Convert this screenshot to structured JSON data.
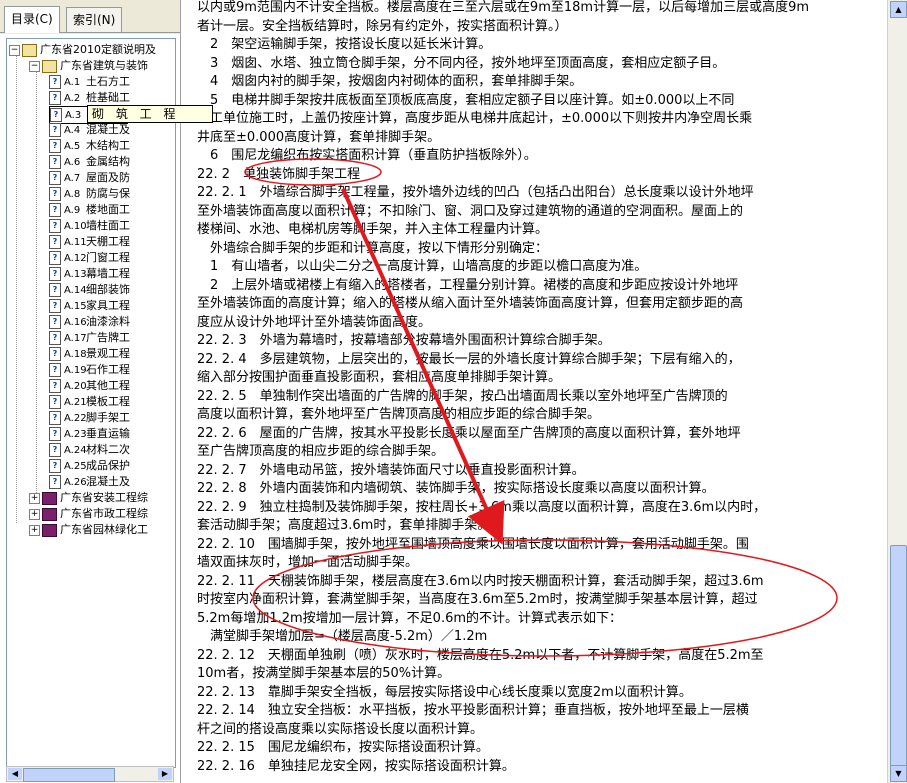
{
  "tabs": {
    "contents": "目录(C)",
    "index": "索引(N)"
  },
  "tree": {
    "root": "广东省2010定额说明及",
    "group1": "广东省建筑与装饰",
    "items": [
      {
        "code": "A.1",
        "label": "土石方工"
      },
      {
        "code": "A.2",
        "label": "桩基础工"
      },
      {
        "code": "A.3",
        "label": "砌 筑 工"
      },
      {
        "code": "A.4",
        "label": "混凝土及"
      },
      {
        "code": "A.5",
        "label": "木结构工"
      },
      {
        "code": "A.6",
        "label": "金属结构"
      },
      {
        "code": "A.7",
        "label": "屋面及防"
      },
      {
        "code": "A.8",
        "label": "防腐与保"
      },
      {
        "code": "A.9",
        "label": "楼地面工"
      },
      {
        "code": "A.10",
        "label": "墙柱面工"
      },
      {
        "code": "A.11",
        "label": "天棚工程"
      },
      {
        "code": "A.12",
        "label": "门窗工程"
      },
      {
        "code": "A.13",
        "label": "幕墙工程"
      },
      {
        "code": "A.14",
        "label": "细部装饰"
      },
      {
        "code": "A.15",
        "label": "家具工程"
      },
      {
        "code": "A.16",
        "label": "油漆涂料"
      },
      {
        "code": "A.17",
        "label": "广告牌工"
      },
      {
        "code": "A.18",
        "label": "景观工程"
      },
      {
        "code": "A.19",
        "label": "石作工程"
      },
      {
        "code": "A.20",
        "label": "其他工程"
      },
      {
        "code": "A.21",
        "label": "模板工程"
      },
      {
        "code": "A.22",
        "label": "脚手架工"
      },
      {
        "code": "A.23",
        "label": "垂直运输"
      },
      {
        "code": "A.24",
        "label": "材料二次"
      },
      {
        "code": "A.25",
        "label": "成品保护"
      },
      {
        "code": "A.26",
        "label": "混凝土及"
      }
    ],
    "group2": "广东省安装工程综",
    "group3": "广东省市政工程综",
    "group4": "广东省园林绿化工"
  },
  "tooltip": "砌 筑 工 程",
  "content": {
    "lines": [
      "以内或9m范围内不计安全挡板。楼层高度在三至六层或在9m至18m计算一层，以后每增加三层或高度9m",
      "者计一层。安全挡板结算时，除另有约定外，按实搭面积计算。）",
      "　2　架空运输脚手架，按搭设长度以延长米计算。",
      "　3　烟囱、水塔、独立筒仓脚手架，分不同内径，按外地坪至顶面高度，套相应定额子目。",
      "　4　烟囱内衬的脚手架，按烟囱内衬砌体的面积，套单排脚手架。",
      "　5　电梯井脚手架按井底板面至顶板底高度，套相应定额子目以座计算。如±0.000以上不同",
      "施工单位施工时，上盖仍按座计算，高度步距从电梯井底起计，±0.000以下则按井内净空周长乘",
      "井底至±0.000高度计算，套单排脚手架。",
      "　6　围尼龙编织布按实搭面积计算（垂直防护挡板除外）。",
      "22. 2　单独装饰脚手架工程",
      "22. 2. 1　外墙综合脚手架工程量，按外墙外边线的凹凸（包括凸出阳台）总长度乘以设计外地坪",
      "至外墙装饰面高度以面积计算；不扣除门、窗、洞口及穿过建筑物的通道的空洞面积。屋面上的",
      "楼梯间、水池、电梯机房等脚手架，并入主体工程量内计算。",
      "　外墙综合脚手架的步距和计算高度，按以下情形分别确定：",
      "　1　有山墙者，以山尖二分之一高度计算，山墙高度的步距以檐口高度为准。",
      "　2　上层外墙或裙楼上有缩入的塔楼者，工程量分别计算。裙楼的高度和步距应按设计外地坪",
      "至外墙装饰面的高度计算；缩入的塔楼从缩入面计至外墙装饰面高度计算，但套用定额步距的高",
      "度应从设计外地坪计至外墙装饰面高度。",
      "22. 2. 3　外墙为幕墙时，按幕墙部分按幕墙外围面积计算综合脚手架。",
      "22. 2. 4　多层建筑物，上层突出的，按最长一层的外墙长度计算综合脚手架；下层有缩入的，",
      "缩入部分按围护面垂直投影面积，套相应高度单排脚手架计算。",
      "22. 2. 5　单独制作突出墙面的广告牌的脚手架，按凸出墙面周长乘以室外地坪至广告牌顶的",
      "高度以面积计算，套外地坪至广告牌顶高度的相应步距的综合脚手架。",
      "22. 2. 6　屋面的广告牌，按其水平投影长度乘以屋面至广告牌顶的高度以面积计算，套外地坪",
      "至广告牌顶高度的相应步距的综合脚手架。",
      "22. 2. 7　外墙电动吊篮，按外墙装饰面尺寸以垂直投影面积计算。",
      "22. 2. 8　外墙内面装饰和内墙砌筑、装饰脚手架，按实际搭设长度乘以高度以面积计算。",
      "22. 2. 9　独立柱捣制及装饰脚手架，按柱周长+3.6m乘以高度以面积计算，高度在3.6m以内时，",
      "套活动脚手架；高度超过3.6m时，套单排脚手架。",
      "22. 2. 10　围墙脚手架，按外地坪至围墙顶高度乘以围墙长度以面积计算，套用活动脚手架。围",
      "墙双面抹灰时，增加一面活动脚手架。",
      "22. 2. 11　天棚装饰脚手架，楼层高度在3.6m以内时按天棚面积计算，套活动脚手架，超过3.6m",
      "时按室内净面积计算，套满堂脚手架，当高度在3.6m至5.2m时，按满堂脚手架基本层计算，超过",
      "5.2m每增加1.2m按增加一层计算，不足0.6m的不计。计算式表示如下：",
      "　满堂脚手架增加层=（楼层高度-5.2m）／1.2m",
      "22. 2. 12　天棚面单独刷（喷）灰水时，楼层高度在5.2m以下者，不计算脚手架，高度在5.2m至",
      "10m者，按满堂脚手架基本层的50%计算。",
      "22. 2. 13　靠脚手架安全挡板，每层按实际搭设中心线长度乘以宽度2m以面积计算。",
      "22. 2. 14　独立安全挡板：水平挡板，按水平投影面积计算；垂直挡板，按外地坪至最上一层横",
      "杆之间的搭设高度乘以实际搭设长度以面积计算。",
      "22. 2. 15　围尼龙编织布，按实际搭设面积计算。",
      "22. 2. 16　单独挂尼龙安全网，按实际搭设面积计算。"
    ]
  },
  "colors": {
    "annotation": "#e0191e",
    "selection": "#316ac5",
    "scroll": "#c1d3fb"
  }
}
